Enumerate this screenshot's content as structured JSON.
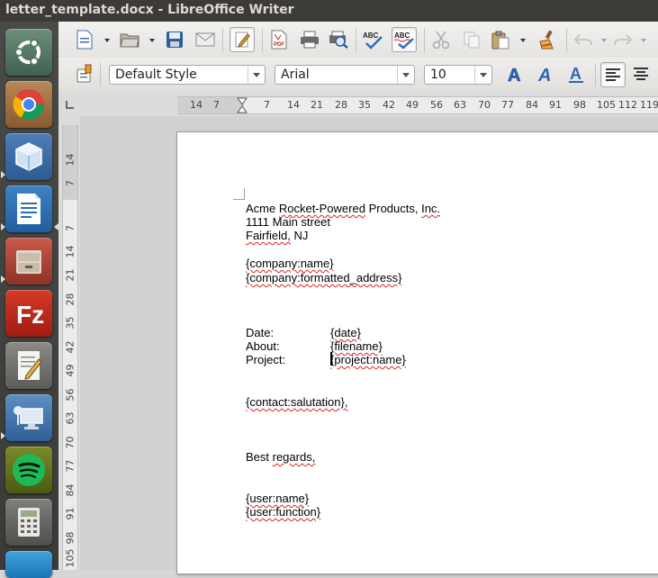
{
  "window": {
    "title": "letter_template.docx - LibreOffice Writer"
  },
  "formatting": {
    "paragraph_style": "Default Style",
    "font_name": "Arial",
    "font_size": "10"
  },
  "ruler": {
    "horizontal": [
      "14",
      "7",
      "7",
      "14",
      "21",
      "28",
      "35",
      "42",
      "49",
      "56",
      "63",
      "70",
      "77",
      "84",
      "91",
      "98",
      "105",
      "112",
      "119"
    ],
    "vertical": [
      "14",
      "7",
      "7",
      "14",
      "21",
      "28",
      "35",
      "42",
      "49",
      "56",
      "63",
      "70",
      "77",
      "84",
      "91",
      "98",
      "105"
    ]
  },
  "document": {
    "sender": [
      "Acme Rocket-Powered Products, Inc.",
      "1111 Main street",
      "Fairfield, NJ"
    ],
    "recipient": [
      "{company:name}",
      "{company:formatted_address}"
    ],
    "fields": [
      {
        "label": "Date:",
        "value": "{date}"
      },
      {
        "label": "About:",
        "value": "{filename}"
      },
      {
        "label": "Project:",
        "value": "{project:name}"
      }
    ],
    "salutation": "{contact:salutation},",
    "closing": "Best regards,",
    "signature": [
      "{user:name}",
      "{user:function}"
    ]
  },
  "colors": {
    "spellcheck": "#d22222",
    "launcher_bg": "#3c3b37",
    "page_bg": "#ffffff"
  }
}
